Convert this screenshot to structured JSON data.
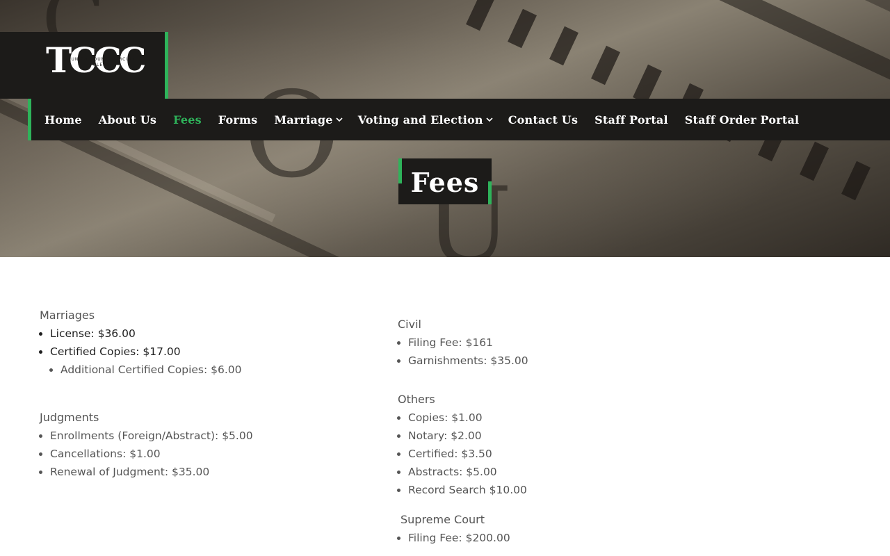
{
  "logo": {
    "text": "TCCC",
    "subtitle": "TUNICA COUNTY CIRCUIT CLERK"
  },
  "nav": {
    "items": [
      {
        "label": "Home"
      },
      {
        "label": "About Us"
      },
      {
        "label": "Fees"
      },
      {
        "label": "Forms"
      },
      {
        "label": "Marriage"
      },
      {
        "label": "Voting and Election"
      },
      {
        "label": "Contact Us"
      },
      {
        "label": "Staff Portal"
      },
      {
        "label": "Staff Order Portal"
      }
    ]
  },
  "page": {
    "title": "Fees"
  },
  "sections": {
    "marriages": {
      "heading": "Marriages",
      "items": [
        "License: $36.00",
        "Certified Copies: $17.00"
      ],
      "subitems": [
        "Additional Certified Copies: $6.00"
      ]
    },
    "judgments": {
      "heading": "Judgments",
      "items": [
        "Enrollments (Foreign/Abstract): $5.00",
        "Cancellations: $1.00",
        "Renewal of Judgment: $35.00"
      ]
    },
    "civil": {
      "heading": "Civil",
      "items": [
        "Filing Fee: $161",
        "Garnishments: $35.00"
      ]
    },
    "others": {
      "heading": "Others",
      "items": [
        "Copies: $1.00",
        "Notary: $2.00",
        "Certified: $3.50",
        "Abstracts: $5.00",
        "Record Search $10.00"
      ]
    },
    "supreme_court": {
      "heading": "Supreme Court",
      "items": [
        "Filing Fee: $200.00"
      ]
    }
  },
  "colors": {
    "accent": "#2eb35a",
    "dark": "#1c1b19",
    "text": "#555555"
  },
  "icons": {
    "dropdown": "chevron-down-icon"
  }
}
